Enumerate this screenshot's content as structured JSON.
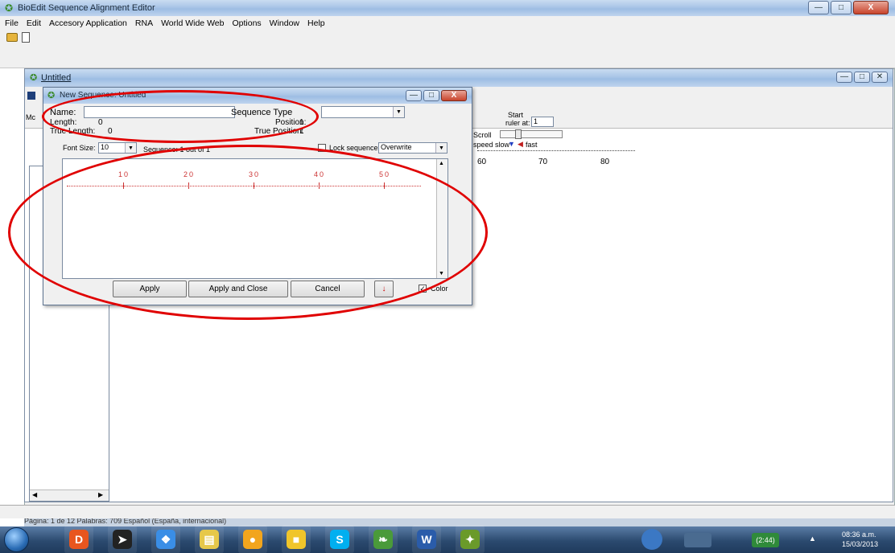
{
  "app": {
    "title": "BioEdit Sequence Alignment Editor",
    "menu": [
      "File",
      "Edit",
      "Accesory Application",
      "RNA",
      "World Wide Web",
      "Options",
      "Window",
      "Help"
    ]
  },
  "doc_window": {
    "title": "Untitled",
    "start_label": "Start",
    "ruler_label": "ruler at:",
    "ruler_value": "1",
    "scroll_label": "Scroll",
    "speed_label": "speed slow",
    "fast_label": "fast",
    "ruler_ticks": [
      "60",
      "70",
      "80"
    ],
    "left_label": "Mc"
  },
  "dialog": {
    "title": "New Sequence: Untitled",
    "name_label": "Name:",
    "name_value": "",
    "sequence_type_label": "Sequence Type",
    "sequence_type_value": "",
    "length_label": "Length:",
    "length_value": "0",
    "true_length_label": "True Length:",
    "true_length_value": "0",
    "position_label": "Position:",
    "position_value": "1",
    "true_position_label": "True Position:",
    "true_position_value": "1",
    "font_size_label": "Font Size:",
    "font_size_value": "10",
    "sequence_counter": "Sequence: 1 out of 1",
    "lock_label": "Lock sequence",
    "mode_value": "Overwrite",
    "ruler_numbers": [
      "10",
      "20",
      "30",
      "40",
      "50"
    ],
    "apply": "Apply",
    "apply_close": "Apply and Close",
    "cancel": "Cancel",
    "color_label": "Color"
  },
  "statusbar": {
    "text": "Página: 1 de 12 Palabras: 709 Español (España, internacional)"
  },
  "taskbar": {
    "items": [
      "start",
      "office",
      "torrent",
      "dropbox",
      "explorer",
      "chrome",
      "folder",
      "skype",
      "photos",
      "word",
      "bioedit"
    ],
    "clock_time": "08:36 a.m.",
    "clock_date": "15/03/2013",
    "battery": "(2:44)"
  },
  "colors": {
    "annotation": "#e00000",
    "ruler": "#cc3333",
    "taskbar": "#2b4a6f"
  }
}
